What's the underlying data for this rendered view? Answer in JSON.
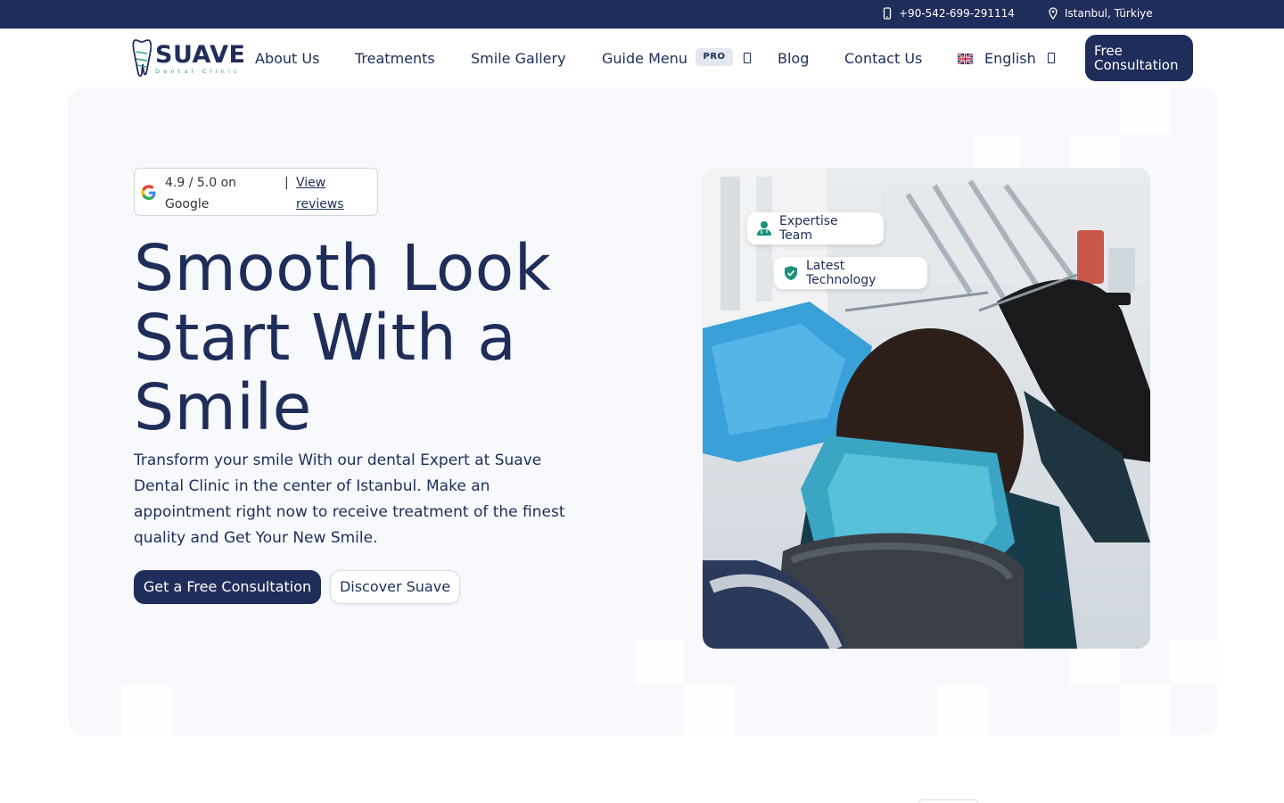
{
  "topbar": {
    "phone": "+90-542-699-291114",
    "location": "Istanbul, Türkiye",
    "phone_icon": "phone-icon",
    "location_icon": "map-pin-icon"
  },
  "nav": {
    "logo": {
      "word": "SUAVE",
      "sub": "Dental Clinic"
    },
    "links": {
      "about": "About Us",
      "treatments": "Treatments",
      "gallery": "Smile Gallery",
      "guide": "Guide Menu",
      "guide_badge": "PRO",
      "blog": "Blog",
      "contact": "Contact Us"
    },
    "language": "English",
    "cta": "Free Consultation"
  },
  "hero": {
    "rating": {
      "text": "4.9 / 5.0 on Google",
      "separator": "|",
      "link": "View reviews"
    },
    "title": "Smooth Look Start With a Smile",
    "description": "Transform your smile With our dental Expert at Suave Dental Clinic in the center of Istanbul. Make an appointment right now to receive treatment of the finest quality and Get Your New Smile.",
    "primary_button": "Get a Free Consultation",
    "secondary_button": "Discover Suave",
    "badges": {
      "team": "Expertise Team",
      "tech": "Latest Technology"
    }
  },
  "colors": {
    "brand_navy": "#1f2d5a",
    "accent_teal": "#1a8f7a",
    "hero_bg": "#f7f9fc"
  }
}
